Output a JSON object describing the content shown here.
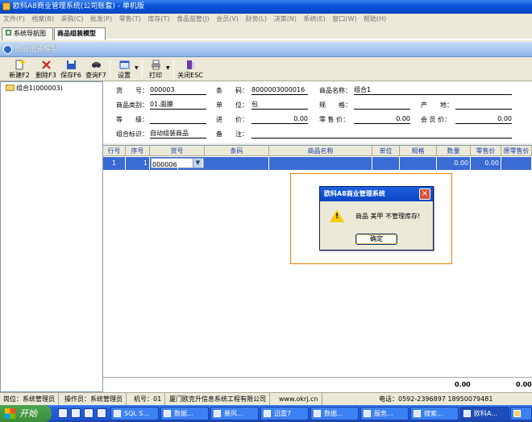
{
  "title": "欧科A8商业管理系统(公司账套) - 单机版",
  "menu": [
    "文件(F)",
    "档案(B)",
    "采购(C)",
    "批发(P)",
    "零售(T)",
    "库存(T)",
    "食品监管(J)",
    "会员(V)",
    "财务(L)",
    "决策(N)",
    "系统(E)",
    "窗口(W)",
    "帮助(H)"
  ],
  "tabs": [
    {
      "label": "系统导航图"
    },
    {
      "label": "商品组装模型"
    }
  ],
  "panel_title": "商品组装模型",
  "toolbar": [
    {
      "label": "新建F2",
      "icon": "new-icon"
    },
    {
      "label": "删除F3",
      "icon": "delete-icon"
    },
    {
      "label": "保存F6",
      "icon": "save-icon"
    },
    {
      "label": "查询F7",
      "icon": "search-icon"
    },
    {
      "label": "设置",
      "icon": "settings-icon"
    },
    {
      "label": "打印",
      "icon": "print-icon"
    },
    {
      "label": "关闭ESC",
      "icon": "close-icon"
    }
  ],
  "tree": {
    "item": "组合1(000003)"
  },
  "form": {
    "huohao_label": "货　　号：",
    "huohao": "000003",
    "tiaoma_label": "条　　码：",
    "tiaoma": "8000003000016",
    "name_label": "商品名称：",
    "name": "组合1",
    "leibie_label": "商品类别：",
    "leibie": "01.面膜",
    "danwei_label": "单　　位：",
    "danwei": "包",
    "guige_label": "规　　格：",
    "guige": "",
    "chandi_label": "产　　地：",
    "chandi": "",
    "dengji_label": "等　　级：",
    "dengji": "",
    "jinjia_label": "进　　价：",
    "jinjia": "0.00",
    "lingshou_label": "零 售 价：",
    "lingshou": "0.00",
    "huiyuan_label": "会 员 价：",
    "huiyuan": "0.00",
    "biaoshi_label": "组合标识：",
    "biaoshi": "自动组装商品",
    "beizhu_label": "备　　注：",
    "beizhu": ""
  },
  "grid": {
    "headers": [
      "行号",
      "序号",
      "货号",
      "条码",
      "商品名称",
      "单位",
      "规格",
      "数量",
      "零售价",
      "原零售价"
    ],
    "row": {
      "hanghao": "1",
      "xuhao": "1",
      "huohao": "000006",
      "tiaoma": "",
      "name": "",
      "danwei": "",
      "guige": "",
      "shuliang": "0.00",
      "lingshou": "0.00"
    },
    "footer_qty": "0.00",
    "footer_price": "0.00"
  },
  "status": {
    "gangwei": "岗位：系统管理员",
    "caozuo": "操作员：系统管理员",
    "jihao": "机号：01",
    "company": "厦门欧克升信息系统工程有限公司",
    "site": "www.okrj.cn",
    "phone": "电话：0592-2396897 18950079481"
  },
  "dialog": {
    "title": "欧科A8商业管理系统",
    "message": "商品 美甲 不管理库存!",
    "ok": "确定"
  },
  "taskbar": {
    "start": "开始",
    "items": [
      "SQL S...",
      "数据...",
      "暴风...",
      "迅雷7",
      "数据...",
      "服务...",
      "搜索...",
      "欧科A...",
      ""
    ]
  }
}
